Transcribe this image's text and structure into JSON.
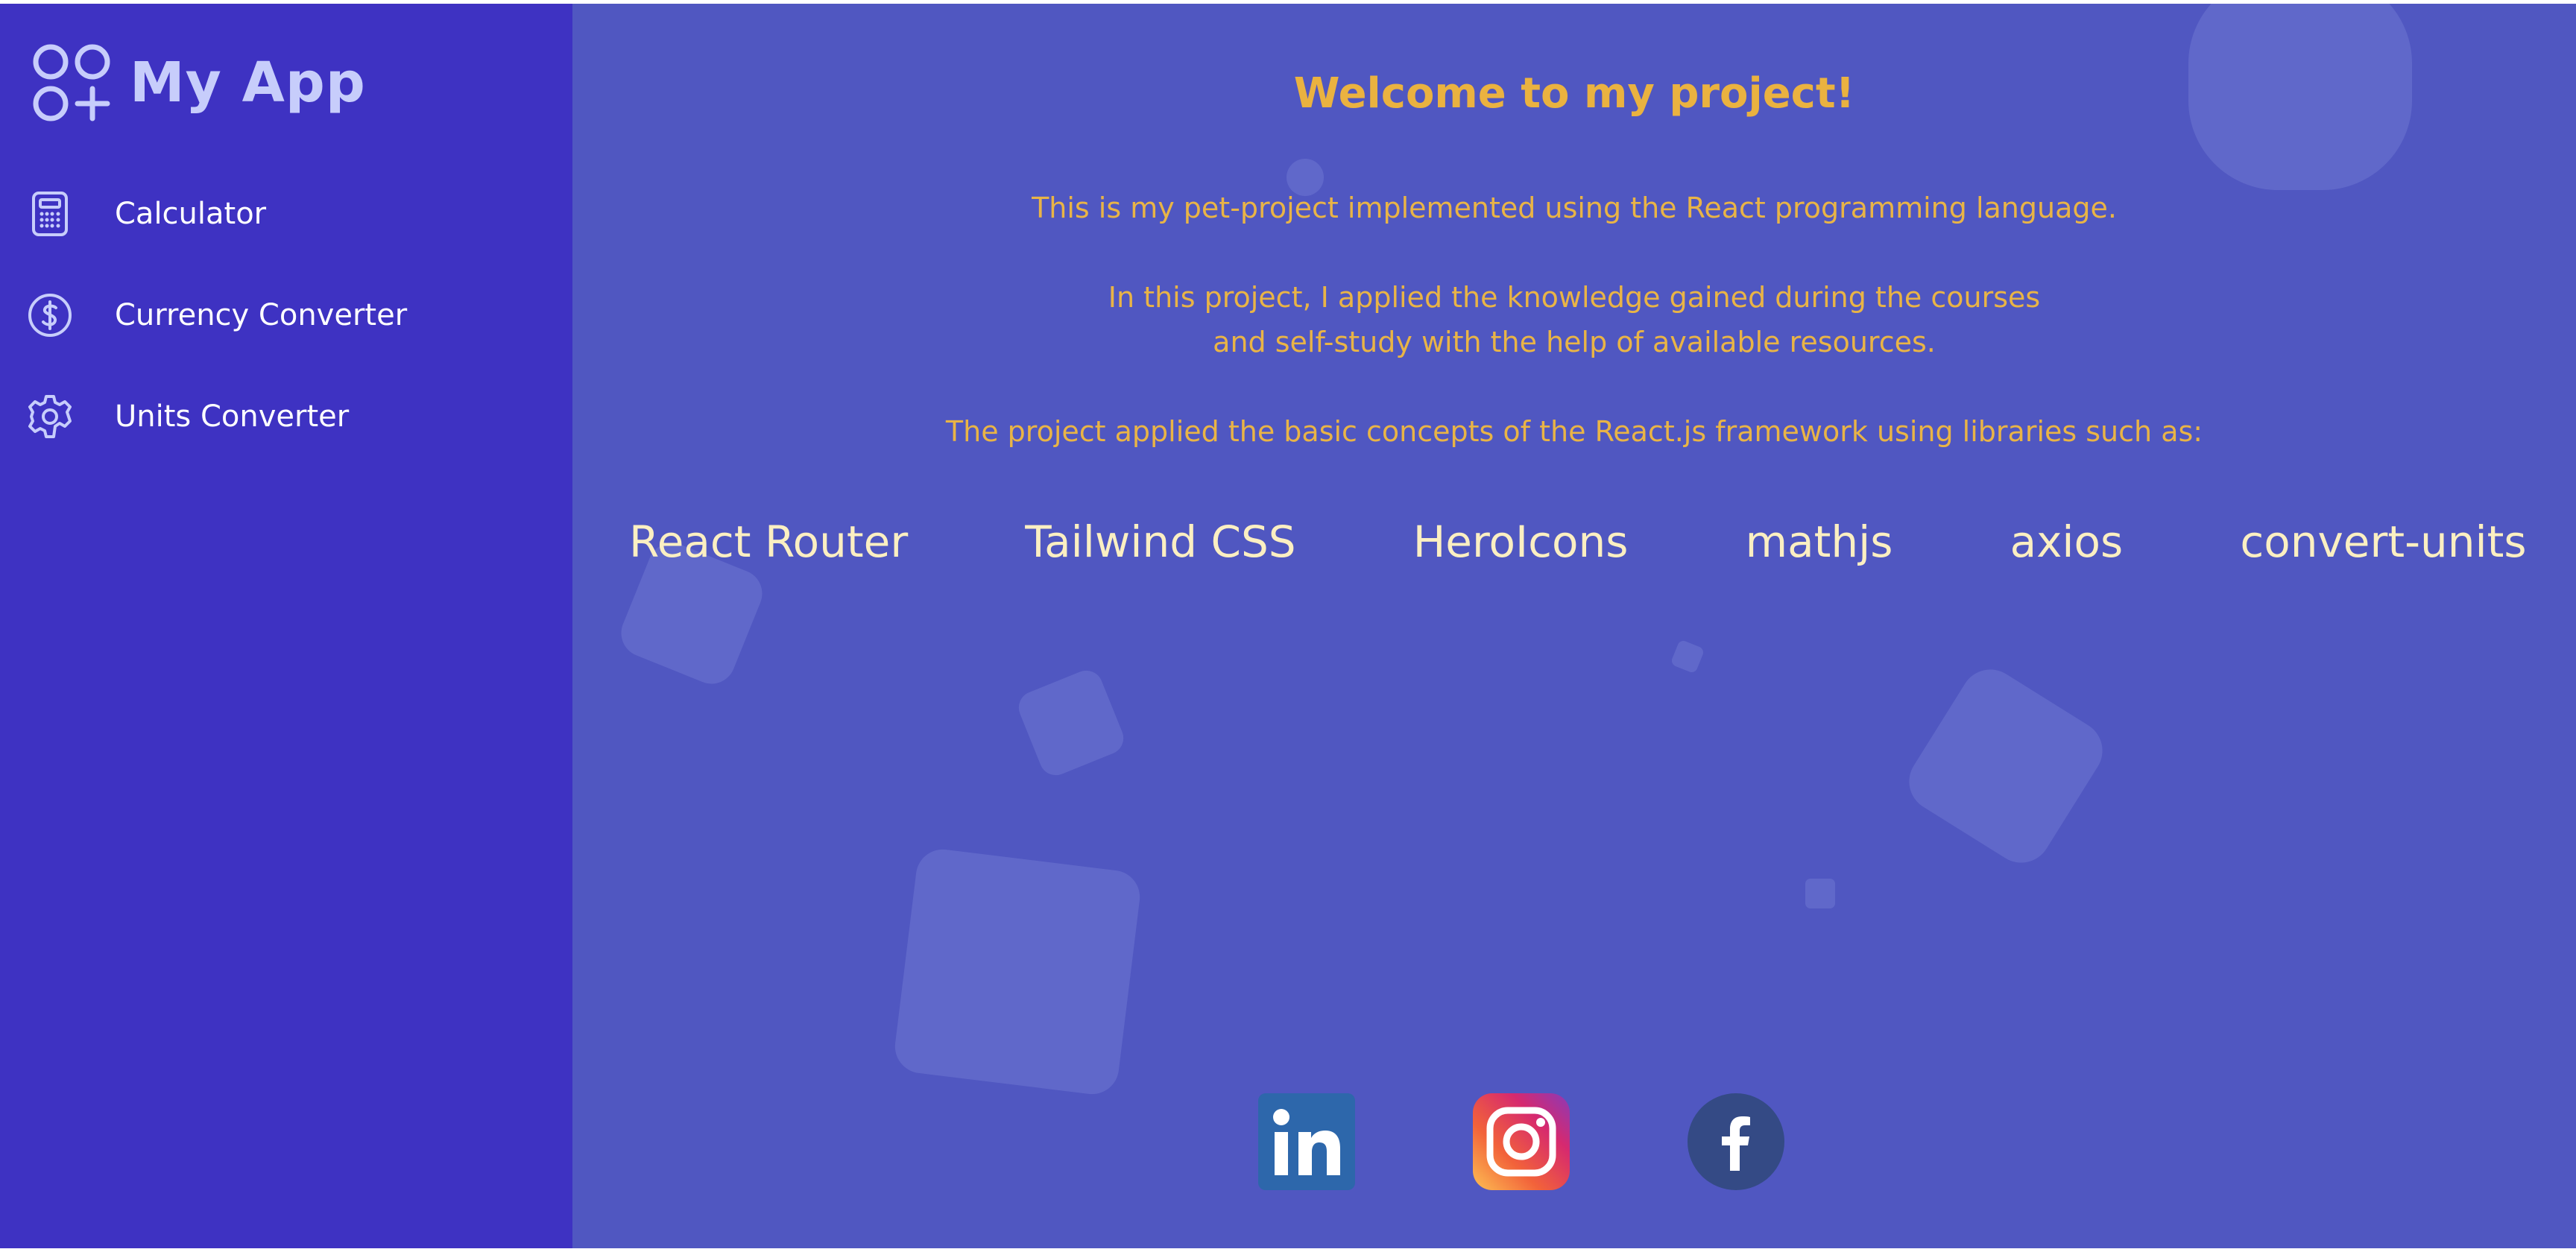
{
  "app": {
    "name": "My App"
  },
  "sidebar": {
    "items": [
      {
        "label": "Calculator",
        "icon": "calculator-icon"
      },
      {
        "label": "Currency Converter",
        "icon": "currency-dollar-icon"
      },
      {
        "label": "Units Converter",
        "icon": "gear-icon"
      }
    ]
  },
  "main": {
    "title": "Welcome to my project!",
    "intro": "This is my pet-project implemented using the React programming language.",
    "knowledge_line1": "In this project, I applied the knowledge gained during the courses",
    "knowledge_line2": "and self-study with the help of available resources.",
    "libs_intro": "The project applied the basic concepts of the React.js framework using libraries such as:",
    "libraries": [
      "React Router",
      "Tailwind CSS",
      "HeroIcons",
      "mathjs",
      "axios",
      "convert-units"
    ]
  },
  "social": [
    {
      "icon": "linkedin-icon",
      "color": "#2d67ab"
    },
    {
      "icon": "instagram-icon",
      "color": "#e1306c"
    },
    {
      "icon": "facebook-icon",
      "color": "#344a85"
    }
  ],
  "colors": {
    "sidebar_bg": "#3e32c2",
    "main_bg": "#5057c1",
    "accent": "#eab240",
    "library_text": "#fbefc2"
  }
}
